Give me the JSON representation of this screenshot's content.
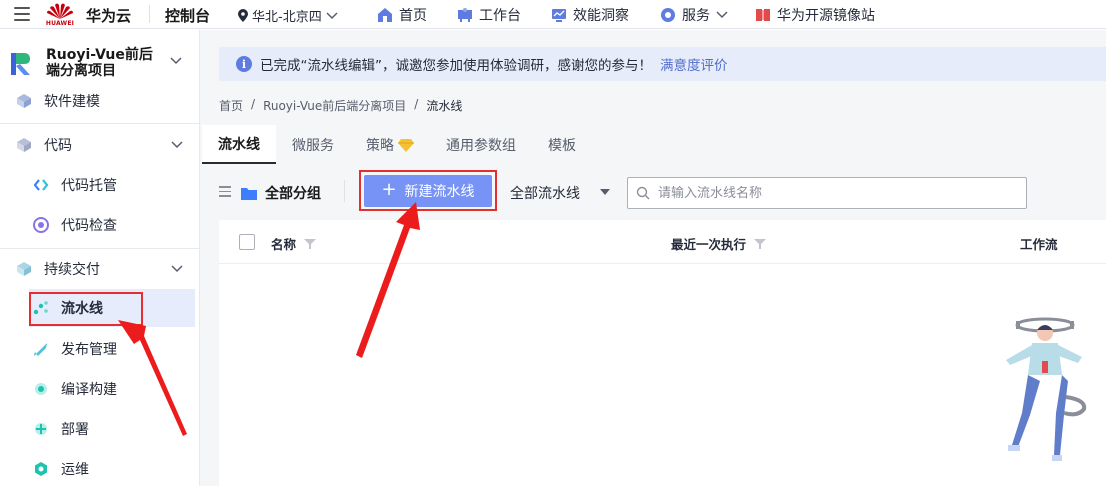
{
  "topbar": {
    "logo_text": "HUAWEI",
    "brand": "华为云",
    "console": "控制台",
    "region": "华北-北京四",
    "nav": [
      {
        "label": "首页",
        "icon": "home-icon"
      },
      {
        "label": "工作台",
        "icon": "workbench-icon"
      },
      {
        "label": "效能洞察",
        "icon": "insight-icon"
      },
      {
        "label": "服务",
        "icon": "service-icon"
      },
      {
        "label": "华为开源镜像站",
        "icon": "mirror-icon"
      }
    ]
  },
  "sidebar": {
    "project_name": "Ruoyi-Vue前后端分离项目",
    "items": [
      {
        "label": "软件建模",
        "icon": "modeling-icon"
      },
      {
        "label": "代码",
        "icon": "code-icon"
      },
      {
        "label": "代码托管",
        "icon": "code-hosting-icon"
      },
      {
        "label": "代码检查",
        "icon": "code-check-icon"
      },
      {
        "label": "持续交付",
        "icon": "delivery-icon"
      },
      {
        "label": "流水线",
        "icon": "pipeline-icon"
      },
      {
        "label": "发布管理",
        "icon": "release-icon"
      },
      {
        "label": "编译构建",
        "icon": "build-icon"
      },
      {
        "label": "部署",
        "icon": "deploy-icon"
      },
      {
        "label": "运维",
        "icon": "ops-icon"
      }
    ]
  },
  "banner": {
    "text": "已完成“流水线编辑”，诚邀您参加使用体验调研，感谢您的参与！",
    "link": "满意度评价"
  },
  "breadcrumb": {
    "items": [
      "首页",
      "Ruoyi-Vue前后端分离项目",
      "流水线"
    ],
    "sep": "/"
  },
  "tabs": [
    "流水线",
    "微服务",
    "策略",
    "通用参数组",
    "模板"
  ],
  "toolbar": {
    "group_label": "全部分组",
    "new_button": "新建流水线",
    "filter_label": "全部流水线",
    "search_placeholder": "请输入流水线名称"
  },
  "table": {
    "columns": [
      "名称",
      "最近一次执行",
      "工作流"
    ]
  },
  "colors": {
    "accent": "#7693f5",
    "highlight_red": "#e62e2e",
    "active_bg": "#e6ecfb"
  }
}
